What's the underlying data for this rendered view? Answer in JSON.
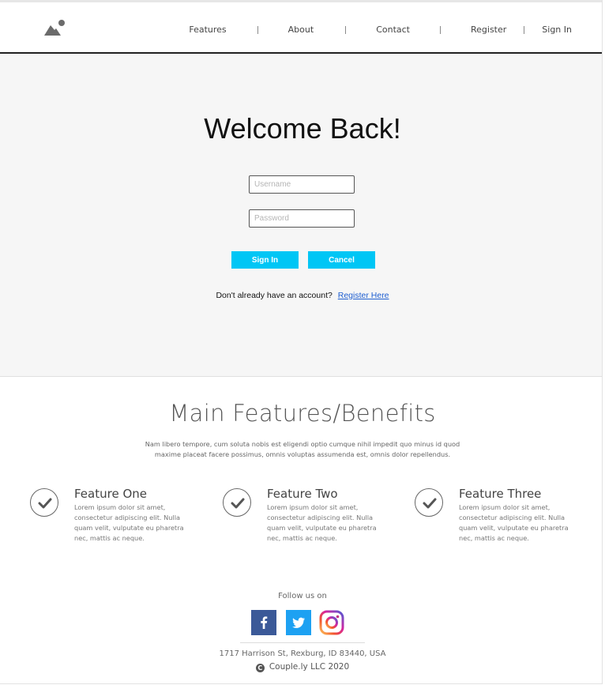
{
  "nav": {
    "items": [
      "Features",
      "About",
      "Contact",
      "Register",
      "Sign In"
    ]
  },
  "hero": {
    "title": "Welcome Back!",
    "username_placeholder": "Username",
    "password_placeholder": "Password",
    "signin_label": "Sign In",
    "cancel_label": "Cancel",
    "prompt_text": "Don't already have an account?",
    "register_link": "Register Here"
  },
  "features": {
    "title": "Main Features/Benefits",
    "description": "Nam libero tempore, cum soluta nobis est eligendi optio cumque nihil impedit quo minus id quod maxime placeat facere possimus, omnis voluptas assumenda est, omnis dolor repellendus.",
    "items": [
      {
        "name": "Feature One",
        "text": "Lorem ipsum dolor sit amet, consectetur adipiscing elit. Nulla quam velit, vulputate eu pharetra nec, mattis ac neque."
      },
      {
        "name": "Feature Two",
        "text": "Lorem ipsum dolor sit amet, consectetur adipiscing elit. Nulla quam velit, vulputate eu pharetra nec, mattis ac neque."
      },
      {
        "name": "Feature Three",
        "text": "Lorem ipsum dolor sit amet, consectetur adipiscing elit. Nulla quam velit, vulputate eu pharetra nec, mattis ac neque."
      }
    ]
  },
  "footer": {
    "follow_text": "Follow us on",
    "social_icons": [
      "facebook-icon",
      "twitter-icon",
      "instagram-icon"
    ],
    "address": "1717 Harrison St, Rexburg, ID 83440, USA",
    "copyright": "Couple.ly LLC 2020"
  },
  "colors": {
    "accent": "#00c6f5",
    "link": "#1f5fd1",
    "facebook": "#3b5998",
    "twitter": "#1da1f2"
  }
}
